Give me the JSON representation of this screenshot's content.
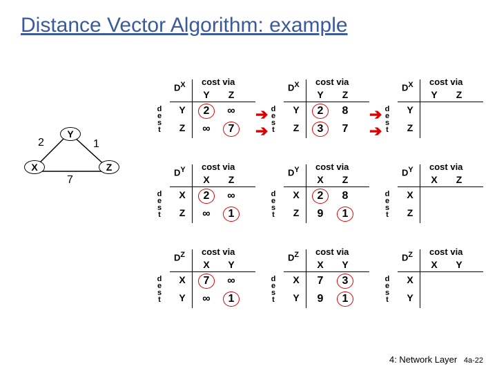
{
  "title": "Distance Vector Algorithm: example",
  "footer": {
    "chapter": "4: Network Layer",
    "page": "4a-22"
  },
  "graph": {
    "nodes": {
      "X": "X",
      "Y": "Y",
      "Z": "Z"
    },
    "edges": {
      "xy": "2",
      "yz": "1",
      "xz": "7"
    }
  },
  "ui": {
    "costvia": "cost via",
    "dest": [
      "d",
      "e",
      "s",
      "t"
    ],
    "D": "D"
  },
  "tables": {
    "c0": {
      "X": {
        "corner": "X",
        "cols": [
          "Y",
          "Z"
        ],
        "rows": [
          "Y",
          "Z"
        ],
        "cells": [
          [
            "2",
            "∞"
          ],
          [
            "∞",
            "7"
          ]
        ],
        "circled": [
          [
            0,
            0
          ],
          [
            1,
            1
          ]
        ]
      },
      "Y": {
        "corner": "Y",
        "cols": [
          "X",
          "Z"
        ],
        "rows": [
          "X",
          "Z"
        ],
        "cells": [
          [
            "2",
            "∞"
          ],
          [
            "∞",
            "1"
          ]
        ],
        "circled": [
          [
            0,
            0
          ],
          [
            1,
            1
          ]
        ]
      },
      "Z": {
        "corner": "Z",
        "cols": [
          "X",
          "Y"
        ],
        "rows": [
          "X",
          "Y"
        ],
        "cells": [
          [
            "7",
            "∞"
          ],
          [
            "∞",
            "1"
          ]
        ],
        "circled": [
          [
            0,
            0
          ],
          [
            1,
            1
          ]
        ]
      }
    },
    "c1": {
      "X": {
        "corner": "X",
        "cols": [
          "Y",
          "Z"
        ],
        "rows": [
          "Y",
          "Z"
        ],
        "cells": [
          [
            "2",
            "8"
          ],
          [
            "3",
            "7"
          ]
        ],
        "circled": [
          [
            0,
            0
          ],
          [
            1,
            0
          ]
        ]
      },
      "Y": {
        "corner": "Y",
        "cols": [
          "X",
          "Z"
        ],
        "rows": [
          "X",
          "Z"
        ],
        "cells": [
          [
            "2",
            "8"
          ],
          [
            "9",
            "1"
          ]
        ],
        "circled": [
          [
            0,
            0
          ],
          [
            1,
            1
          ]
        ]
      },
      "Z": {
        "corner": "Z",
        "cols": [
          "X",
          "Y"
        ],
        "rows": [
          "X",
          "Y"
        ],
        "cells": [
          [
            "7",
            "3"
          ],
          [
            "9",
            "1"
          ]
        ],
        "circled": [
          [
            0,
            1
          ],
          [
            1,
            1
          ]
        ]
      }
    },
    "c2": {
      "X": {
        "corner": "X",
        "cols": [
          "Y",
          "Z"
        ],
        "rows": [
          "Y",
          "Z"
        ],
        "cells": [
          [
            "",
            ""
          ],
          [
            "",
            ""
          ]
        ],
        "circled": []
      },
      "Y": {
        "corner": "Y",
        "cols": [
          "X",
          "Z"
        ],
        "rows": [
          "X",
          "Z"
        ],
        "cells": [
          [
            "",
            ""
          ],
          [
            "",
            ""
          ]
        ],
        "circled": []
      },
      "Z": {
        "corner": "Z",
        "cols": [
          "X",
          "Y"
        ],
        "rows": [
          "X",
          "Y"
        ],
        "cells": [
          [
            "",
            ""
          ],
          [
            "",
            ""
          ]
        ],
        "circled": []
      }
    }
  }
}
